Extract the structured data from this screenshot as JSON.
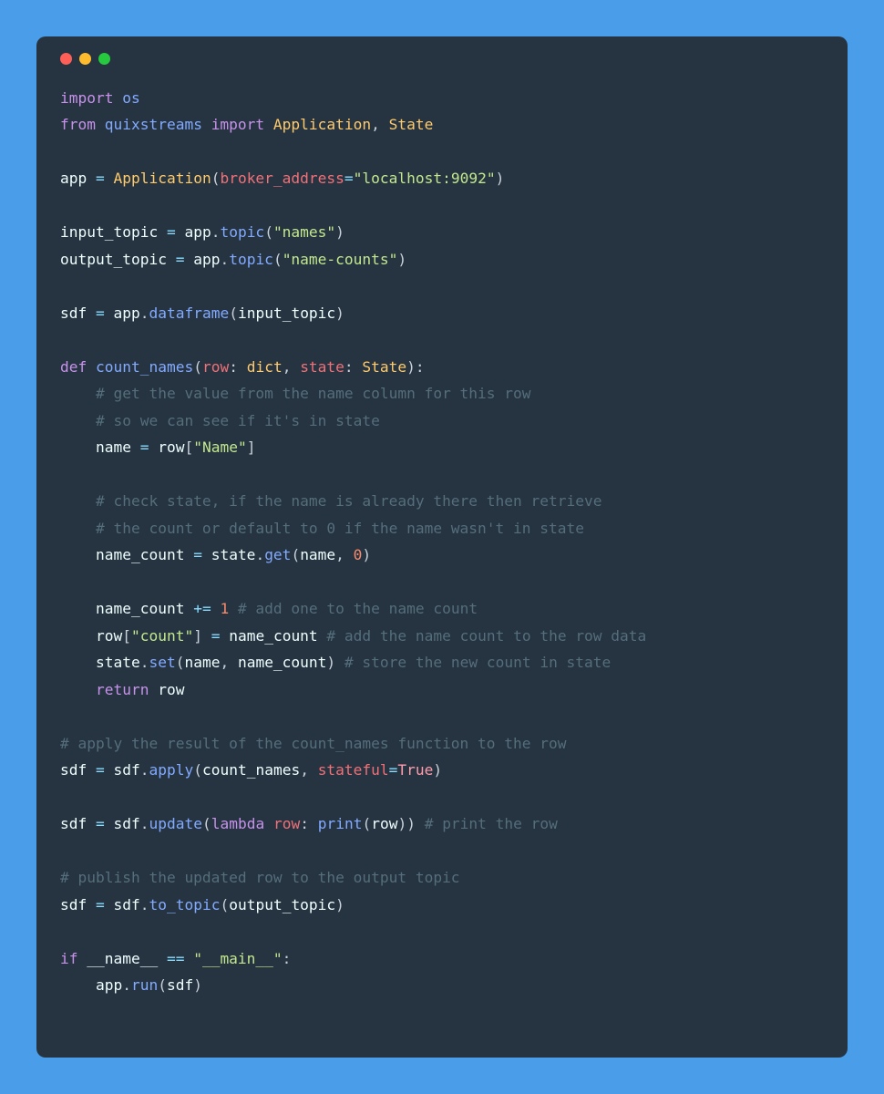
{
  "window": {
    "dots": [
      "red",
      "yellow",
      "green"
    ]
  },
  "code": {
    "l1_import": "import",
    "l1_os": "os",
    "l2_from": "from",
    "l2_quix": "quixstreams",
    "l2_import": "import",
    "l2_app": "Application",
    "l2_state": "State",
    "l4_app": "app",
    "l4_eq": " = ",
    "l4_appcls": "Application",
    "l4_kw": "broker_address",
    "l4_val": "\"localhost:9092\"",
    "l6_input": "input_topic",
    "l6_eq": " = ",
    "l6_app": "app",
    "l6_topic": "topic",
    "l6_val": "\"names\"",
    "l7_output": "output_topic",
    "l7_eq": " = ",
    "l7_app": "app",
    "l7_topic": "topic",
    "l7_val": "\"name-counts\"",
    "l9_sdf": "sdf",
    "l9_eq": " = ",
    "l9_app": "app",
    "l9_df": "dataframe",
    "l9_arg": "input_topic",
    "l11_def": "def",
    "l11_fn": "count_names",
    "l11_row": "row",
    "l11_dict": "dict",
    "l11_state": "state",
    "l11_statecls": "State",
    "l12_cmt": "# get the value from the name column for this row",
    "l13_cmt": "# so we can see if it's in state",
    "l14_name": "name",
    "l14_eq": " = ",
    "l14_row": "row",
    "l14_key": "\"Name\"",
    "l16_cmt": "# check state, if the name is already there then retrieve",
    "l17_cmt": "# the count or default to 0 if the name wasn't in state",
    "l18_nc": "name_count",
    "l18_eq": " = ",
    "l18_state": "state",
    "l18_get": "get",
    "l18_name": "name",
    "l18_zero": "0",
    "l20_nc": "name_count",
    "l20_pe": " += ",
    "l20_one": "1",
    "l20_cmt": " # add one to the name count",
    "l21_row": "row",
    "l21_key": "\"count\"",
    "l21_eq": " = ",
    "l21_nc": "name_count",
    "l21_cmt": " # add the name count to the row data",
    "l22_state": "state",
    "l22_set": "set",
    "l22_name": "name",
    "l22_nc": "name_count",
    "l22_cmt": " # store the new count in state",
    "l23_return": "return",
    "l23_row": "row",
    "l25_cmt": "# apply the result of the count_names function to the row",
    "l26_sdf": "sdf",
    "l26_eq": " = ",
    "l26_sdf2": "sdf",
    "l26_apply": "apply",
    "l26_cn": "count_names",
    "l26_stateful": "stateful",
    "l26_true": "True",
    "l28_sdf": "sdf",
    "l28_eq": " = ",
    "l28_sdf2": "sdf",
    "l28_update": "update",
    "l28_lambda": "lambda",
    "l28_row": "row",
    "l28_print": "print",
    "l28_row2": "row",
    "l28_cmt": " # print the row",
    "l30_cmt": "# publish the updated row to the output topic",
    "l31_sdf": "sdf",
    "l31_eq": " = ",
    "l31_sdf2": "sdf",
    "l31_tt": "to_topic",
    "l31_ot": "output_topic",
    "l33_if": "if",
    "l33_name": "__name__",
    "l33_eq": " == ",
    "l33_main": "\"__main__\"",
    "l34_app": "app",
    "l34_run": "run",
    "l34_sdf": "sdf"
  }
}
